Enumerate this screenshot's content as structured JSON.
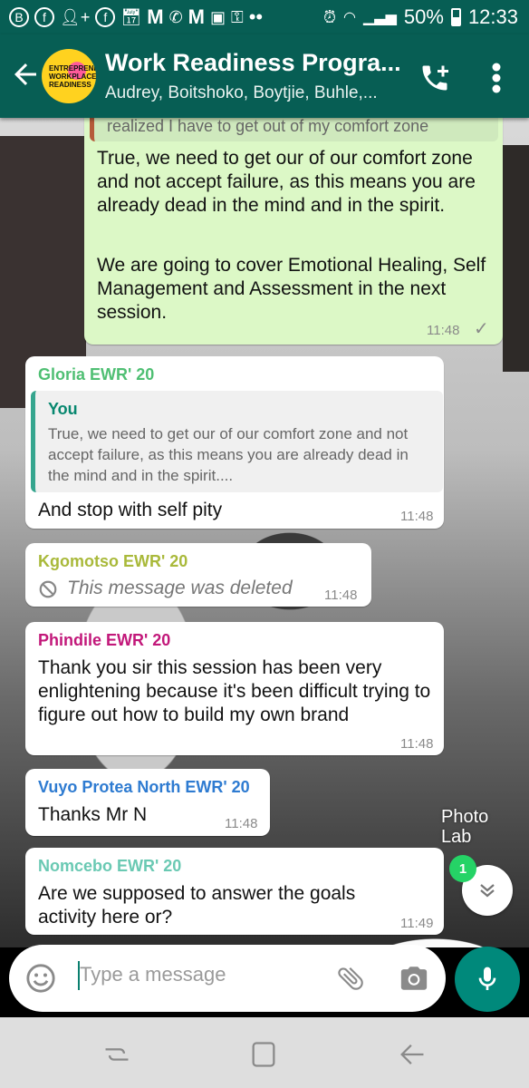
{
  "status": {
    "battery": "50%",
    "time": "12:33"
  },
  "header": {
    "avatar_text": "ENTREPRENEURSHIP WORKPLACE READINESS",
    "title": "Work Readiness Progra...",
    "subtitle": "Audrey, Boitshoko, Boytjie, Buhle,..."
  },
  "messages": {
    "m0": {
      "quote_text": "realized I have to get out of my comfort zone",
      "text_1": "True, we need to get our of our comfort zone and not accept failure, as this means you are already dead in the mind and in the spirit.",
      "text_2": "We are going to cover Emotional Healing, Self Management and Assessment in the next session.",
      "time": "11:48",
      "status": "✓"
    },
    "m1": {
      "sender": "Gloria EWR' 20",
      "sender_color": "#4fbf73",
      "quote_name": "You",
      "quote_text": "True, we need to get our of our comfort zone and not accept failure, as this means you are already dead in the mind and in the spirit....",
      "text": "And stop with self pity",
      "time": "11:48"
    },
    "m2": {
      "sender": "Kgomotso EWR' 20",
      "sender_color": "#a9b93a",
      "text": "This message was deleted",
      "time": "11:48"
    },
    "m3": {
      "sender": "Phindile EWR' 20",
      "sender_color": "#c2187a",
      "text": "Thank you sir this session has been very enlightening because it's been difficult trying to figure out how to build my own brand",
      "time": "11:48"
    },
    "m4": {
      "sender": "Vuyo Protea North EWR' 20",
      "sender_color": "#2e7bd1",
      "text": "Thanks Mr N",
      "time": "11:48"
    },
    "m5": {
      "sender": "Nomcebo EWR' 20",
      "sender_color": "#6ac9b3",
      "text": "Are we supposed to answer the goals activity here or?",
      "time": "11:49"
    }
  },
  "overlay": {
    "unread_count": "1",
    "watermark_1": "Photo",
    "watermark_2": "Lab"
  },
  "input": {
    "placeholder": "Type a message"
  }
}
